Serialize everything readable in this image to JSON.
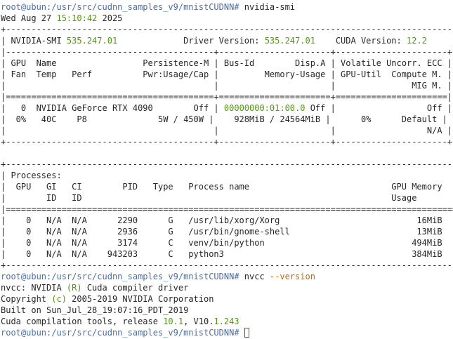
{
  "colors": {
    "prompt": "#4a6fa5",
    "highlight": "#4e9a06",
    "flag": "#c16a00",
    "text": "#262626"
  },
  "prompt": "root@ubun:/usr/src/cudnn_samples_v9/mnistCUDNN# ",
  "cmd1": "nvidia-smi",
  "date": {
    "a": "Wed Aug 27 ",
    "time": "15:10:42",
    "b": " 2025"
  },
  "rule": "+-----------------------------------------------------------------------------------------+",
  "header": {
    "p1": "| NVIDIA-SMI ",
    "smi_version": "535.247.01",
    "p2": "             Driver Version: ",
    "driver_version": "535.247.01",
    "p3": "    CUDA Version: ",
    "cuda_version": "12.2",
    "p4": "     |"
  },
  "gpu_head": [
    "|-----------------------------------------+----------------------+----------------------+",
    "| GPU  Name                 Persistence-M | Bus-Id        Disp.A | Volatile Uncorr. ECC |",
    "| Fan  Temp   Perf          Pwr:Usage/Cap |         Memory-Usage | GPU-Util  Compute M. |",
    "|                                         |                      |               MIG M. |",
    "|=========================================+======================+======================|"
  ],
  "gpu_row1": {
    "a": "|   0  NVIDIA GeForce RTX 4090        Off | ",
    "bus_id": "00000000:01:00.0",
    "b": " Off |                  Off |"
  },
  "gpu_rows": [
    "|  0%   40C    P8              5W / 450W |    928MiB / 24564MiB |      0%      Default |",
    "|                                         |                      |                  N/A |",
    "+-----------------------------------------+----------------------+----------------------+"
  ],
  "blank": "",
  "proc_table": [
    "+-----------------------------------------------------------------------------------------+",
    "| Processes:                                                                              |",
    "|  GPU   GI   CI        PID   Type   Process name                            GPU Memory   |",
    "|        ID   ID                                                             Usage        |",
    "|=========================================================================================|",
    "|    0   N/A  N/A      2290      G   /usr/lib/xorg/Xorg                           16MiB   |",
    "|    0   N/A  N/A      2936      G   /usr/bin/gnome-shell                         13MiB   |",
    "|    0   N/A  N/A      3174      C   venv/bin/python                             494MiB   |",
    "|    0   N/A  N/A    943203      C   python3                                     384MiB   |",
    "+-----------------------------------------------------------------------------------------+"
  ],
  "cmd2": {
    "name": "nvcc ",
    "flag": "--version"
  },
  "nvcc1": {
    "a": "nvcc: NVIDIA ",
    "r": "(R)",
    "b": " Cuda compiler driver"
  },
  "nvcc2": {
    "a": "Copyright ",
    "c": "(c)",
    "b": " 2005-2019 NVIDIA Corporation"
  },
  "nvcc3": "Built on Sun_Jul_28_19:07:16_PDT_2019",
  "nvcc4": {
    "a": "Cuda compilation tools, release ",
    "rel": "10.1",
    "b": ", V10.",
    "ver": "1.243"
  }
}
